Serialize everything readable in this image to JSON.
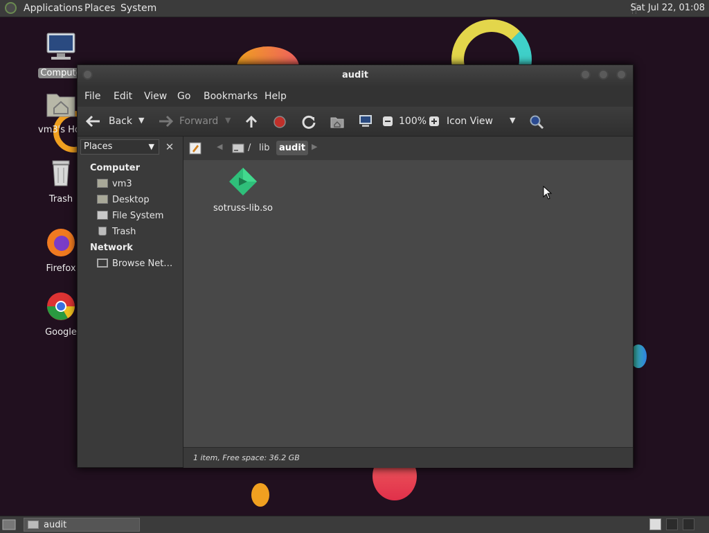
{
  "top_panel": {
    "menus": [
      "Applications",
      "Places",
      "System"
    ],
    "clock": "Sat Jul 22, 01:08"
  },
  "desktop": {
    "icons": [
      {
        "label": "Compute",
        "icon": "computer-icon"
      },
      {
        "label": "vm3's Hor",
        "icon": "home-folder-icon"
      },
      {
        "label": "Trash",
        "icon": "trash-icon"
      },
      {
        "label": "Firefox",
        "icon": "firefox-icon"
      },
      {
        "label": "Google",
        "icon": "chrome-icon"
      }
    ]
  },
  "window": {
    "title": "audit",
    "menu": [
      "File",
      "Edit",
      "View",
      "Go",
      "Bookmarks",
      "Help"
    ],
    "toolbar": {
      "back_label": "Back",
      "forward_label": "Forward",
      "zoom": "100%",
      "view_mode": "Icon View"
    },
    "sidebar": {
      "selector": "Places",
      "sections": [
        {
          "heading": "Computer",
          "items": [
            "vm3",
            "Desktop",
            "File System",
            "Trash"
          ]
        },
        {
          "heading": "Network",
          "items": [
            "Browse Net…"
          ]
        }
      ]
    },
    "path": {
      "separator": "/",
      "segments": [
        "lib",
        "audit"
      ]
    },
    "files": [
      {
        "name": "sotruss-lib.so",
        "icon": "shared-library-icon"
      }
    ],
    "status": "1 item, Free space: 36.2 GB"
  },
  "taskbar": {
    "tasks": [
      {
        "label": "audit"
      }
    ]
  },
  "colors": {
    "desktop_bg": "#21101f",
    "file_icon": "#2fbf7a",
    "stop_red": "#c0302a"
  }
}
